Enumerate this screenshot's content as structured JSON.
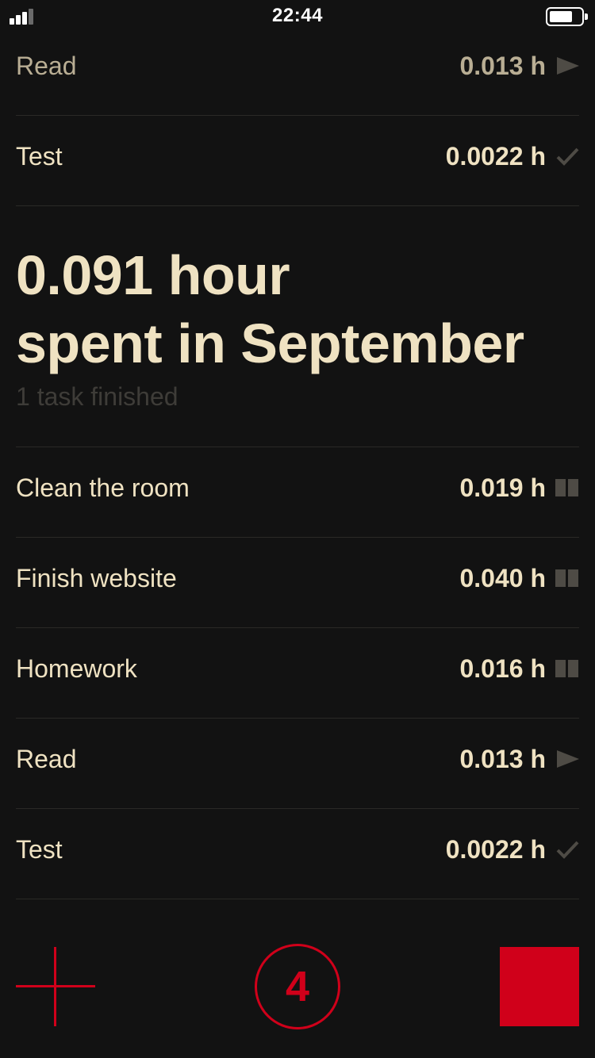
{
  "status_bar": {
    "time": "22:44"
  },
  "top_tasks": [
    {
      "name": "Read",
      "hours": "0.013 h",
      "state": "play"
    },
    {
      "name": "Test",
      "hours": "0.0022 h",
      "state": "done"
    }
  ],
  "summary": {
    "line1": "0.091 hour",
    "line2": "spent in September",
    "subtitle": "1 task finished"
  },
  "tasks": [
    {
      "name": "Clean the room",
      "hours": "0.019 h",
      "state": "pause"
    },
    {
      "name": "Finish website",
      "hours": "0.040 h",
      "state": "pause"
    },
    {
      "name": "Homework",
      "hours": "0.016 h",
      "state": "pause"
    },
    {
      "name": "Read",
      "hours": "0.013 h",
      "state": "play"
    },
    {
      "name": "Test",
      "hours": "0.0022 h",
      "state": "done"
    }
  ],
  "bottom_bar": {
    "count": "4"
  },
  "colors": {
    "accent": "#d0001a",
    "text": "#efe2c2",
    "background": "#121212",
    "icon_muted": "#4e4b45"
  }
}
